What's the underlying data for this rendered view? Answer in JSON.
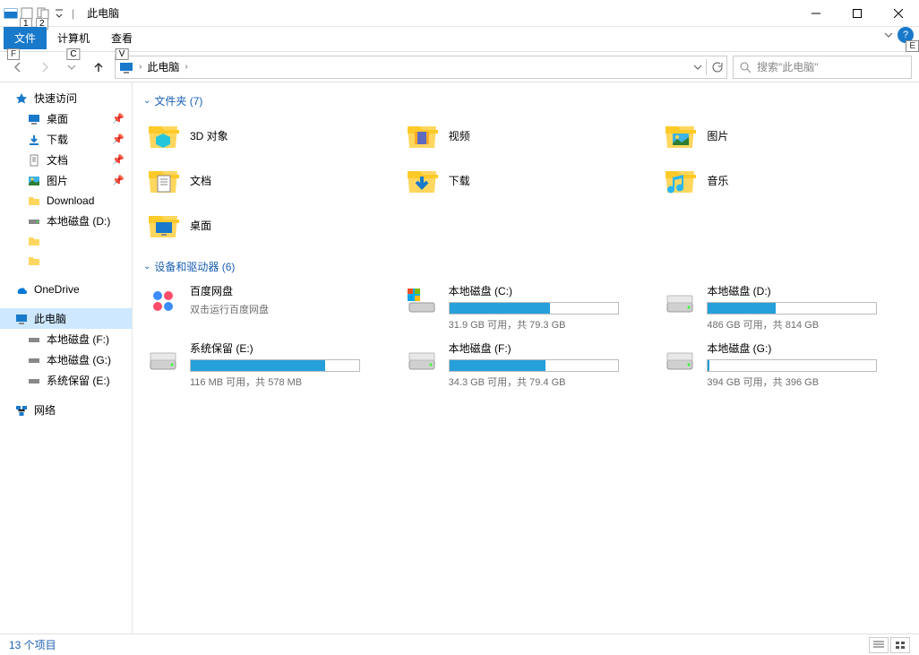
{
  "title": "此电脑",
  "titlebar": {
    "qat_keys": [
      "1",
      "2"
    ],
    "separator": "|"
  },
  "ribbon": {
    "file": {
      "label": "文件",
      "key": "F"
    },
    "tabs": [
      {
        "label": "计算机",
        "key": "C"
      },
      {
        "label": "查看",
        "key": "V"
      }
    ],
    "expand_key": "E"
  },
  "address": {
    "crumb": "此电脑",
    "crumb_sep": "›",
    "search_placeholder": "搜索\"此电脑\""
  },
  "sidebar": {
    "quick_access": "快速访问",
    "items_pinned": [
      {
        "label": "桌面",
        "icon": "desktop"
      },
      {
        "label": "下载",
        "icon": "downloads"
      },
      {
        "label": "文档",
        "icon": "documents"
      },
      {
        "label": "图片",
        "icon": "pictures"
      }
    ],
    "items_recent": [
      {
        "label": "Download",
        "icon": "folder"
      },
      {
        "label": "本地磁盘 (D:)",
        "icon": "drive"
      },
      {
        "label": "",
        "icon": "folder"
      },
      {
        "label": "",
        "icon": "folder"
      }
    ],
    "onedrive": "OneDrive",
    "this_pc": "此电脑",
    "drives": [
      {
        "label": "本地磁盘 (F:)"
      },
      {
        "label": "本地磁盘 (G:)"
      },
      {
        "label": "系统保留 (E:)"
      }
    ],
    "network": "网络"
  },
  "groups": {
    "folders": {
      "title": "文件夹 (7)"
    },
    "devices": {
      "title": "设备和驱动器 (6)"
    }
  },
  "folders": [
    {
      "name": "3D 对象",
      "icon": "3d"
    },
    {
      "name": "视频",
      "icon": "video"
    },
    {
      "name": "图片",
      "icon": "pictures"
    },
    {
      "name": "文档",
      "icon": "documents"
    },
    {
      "name": "下载",
      "icon": "downloads"
    },
    {
      "name": "音乐",
      "icon": "music"
    },
    {
      "name": "桌面",
      "icon": "desktop"
    }
  ],
  "drives": [
    {
      "name": "百度网盘",
      "sub": "双击运行百度网盘",
      "icon": "baidu",
      "bar": null
    },
    {
      "name": "本地磁盘 (C:)",
      "status": "31.9 GB 可用，共 79.3 GB",
      "icon": "windrive",
      "fill": 60
    },
    {
      "name": "本地磁盘 (D:)",
      "status": "486 GB 可用，共 814 GB",
      "icon": "drive",
      "fill": 40
    },
    {
      "name": "系统保留 (E:)",
      "status": "116 MB 可用，共 578 MB",
      "icon": "drive",
      "fill": 80
    },
    {
      "name": "本地磁盘 (F:)",
      "status": "34.3 GB 可用，共 79.4 GB",
      "icon": "drive",
      "fill": 57
    },
    {
      "name": "本地磁盘 (G:)",
      "status": "394 GB 可用，共 396 GB",
      "icon": "drive",
      "fill": 1
    }
  ],
  "statusbar": {
    "count": "13 个项目"
  }
}
